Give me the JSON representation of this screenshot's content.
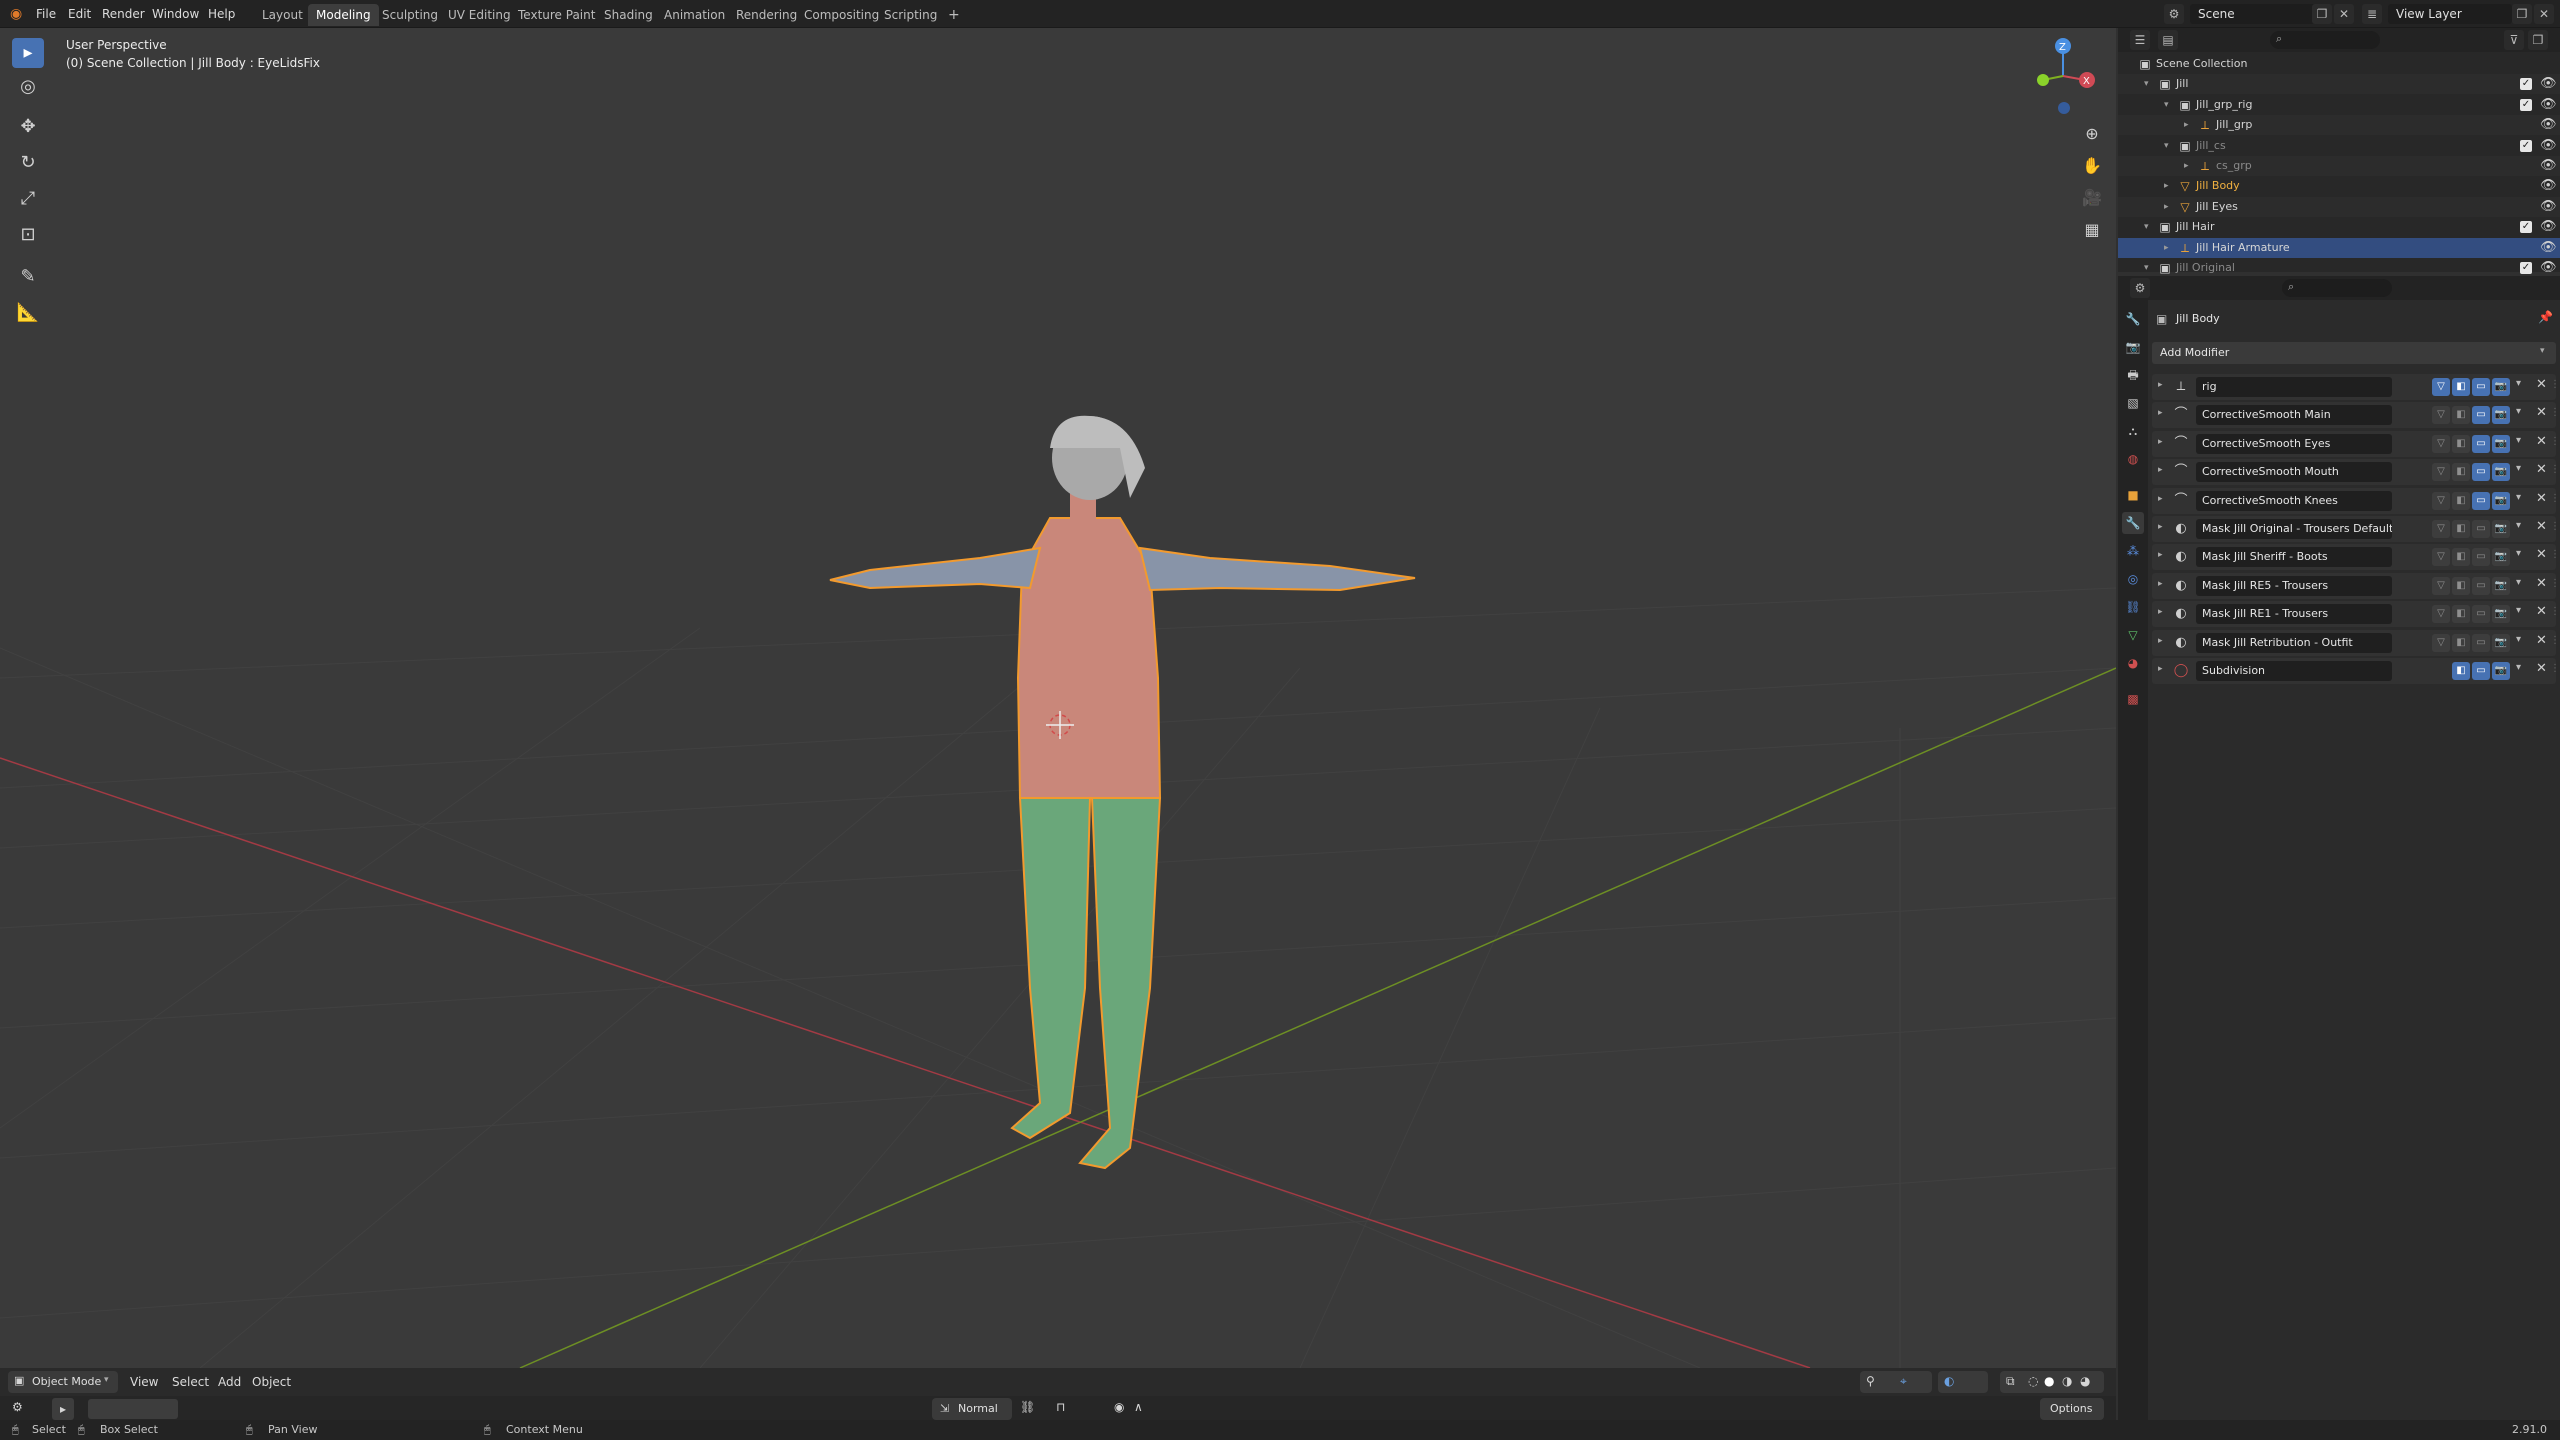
{
  "menu": [
    "File",
    "Edit",
    "Render",
    "Window",
    "Help"
  ],
  "workspaces": [
    "Layout",
    "Modeling",
    "Sculpting",
    "UV Editing",
    "Texture Paint",
    "Shading",
    "Animation",
    "Rendering",
    "Compositing",
    "Scripting"
  ],
  "active_workspace": "Modeling",
  "add_workspace": "+",
  "scene_name": "Scene",
  "view_layer": "View Layer",
  "viewport": {
    "perspective": "User Perspective",
    "context": "(0) Scene Collection | Jill Body : EyeLidsFix",
    "mode": "Object Mode",
    "menus": [
      "View",
      "Select",
      "Add",
      "Object"
    ],
    "shading": "Normal",
    "options": "Options"
  },
  "gizmo": {
    "x": "X",
    "y": "Y",
    "z": "Z"
  },
  "outliner": {
    "rows": [
      {
        "label": "Scene Collection",
        "depth": 0,
        "icon": "collection",
        "check": false,
        "eye": false
      },
      {
        "label": "Jill",
        "depth": 1,
        "icon": "collection",
        "check": true,
        "eye": true
      },
      {
        "label": "Jill_grp_rig",
        "depth": 2,
        "icon": "collection",
        "check": true,
        "eye": true
      },
      {
        "label": "Jill_grp",
        "depth": 3,
        "icon": "armature",
        "check": false,
        "eye": true
      },
      {
        "label": "Jill_cs",
        "depth": 2,
        "icon": "collection",
        "check": true,
        "eye": true,
        "dim": true
      },
      {
        "label": "cs_grp",
        "depth": 3,
        "icon": "armature",
        "check": false,
        "eye": true,
        "dim": true
      },
      {
        "label": "Jill Body",
        "depth": 2,
        "icon": "mesh",
        "check": false,
        "eye": true,
        "highlight": true
      },
      {
        "label": "Jill Eyes",
        "depth": 2,
        "icon": "mesh",
        "check": false,
        "eye": true
      },
      {
        "label": "Jill Hair",
        "depth": 1,
        "icon": "collection",
        "check": true,
        "eye": true
      },
      {
        "label": "Jill Hair Armature",
        "depth": 2,
        "icon": "armature",
        "check": false,
        "eye": true,
        "selected": true
      },
      {
        "label": "Jill Original",
        "depth": 1,
        "icon": "collection",
        "check": true,
        "eye": true,
        "dim": true
      }
    ]
  },
  "properties": {
    "object_name": "Jill Body",
    "add_modifier": "Add Modifier",
    "modifiers": [
      {
        "name": "rig",
        "icon": "armature",
        "editmode": true,
        "viewport": true,
        "render": true
      },
      {
        "name": "CorrectiveSmooth Main",
        "icon": "smooth",
        "editmode": false,
        "viewport": true,
        "render": true
      },
      {
        "name": "CorrectiveSmooth Eyes",
        "icon": "smooth",
        "editmode": false,
        "viewport": true,
        "render": true
      },
      {
        "name": "CorrectiveSmooth Mouth",
        "icon": "smooth",
        "editmode": false,
        "viewport": true,
        "render": true
      },
      {
        "name": "CorrectiveSmooth Knees",
        "icon": "smooth",
        "editmode": false,
        "viewport": true,
        "render": true
      },
      {
        "name": "Mask Jill Original - Trousers Default",
        "icon": "mask",
        "editmode": false,
        "viewport": false,
        "render": false
      },
      {
        "name": "Mask Jill Sheriff - Boots",
        "icon": "mask",
        "editmode": false,
        "viewport": false,
        "render": false
      },
      {
        "name": "Mask Jill RE5 - Trousers",
        "icon": "mask",
        "editmode": false,
        "viewport": false,
        "render": false
      },
      {
        "name": "Mask Jill RE1 - Trousers",
        "icon": "mask",
        "editmode": false,
        "viewport": false,
        "render": false
      },
      {
        "name": "Mask Jill Retribution - Outfit",
        "icon": "mask",
        "editmode": false,
        "viewport": false,
        "render": false
      },
      {
        "name": "Subdivision",
        "icon": "subdivision",
        "editmode": true,
        "viewport": true,
        "render": true
      }
    ]
  },
  "statusbar": {
    "select": "Select",
    "box_select": "Box Select",
    "pan_view": "Pan View",
    "context_menu": "Context Menu",
    "version": "2.91.0"
  },
  "colors": {
    "accent": "#4772b3",
    "selection_outline": "#f29a2e",
    "x_axis": "#b0394a",
    "y_axis": "#7fa32a",
    "skin": "#c9877a",
    "mask_green": "#6aa77a",
    "arm_blue": "#8894a8"
  }
}
